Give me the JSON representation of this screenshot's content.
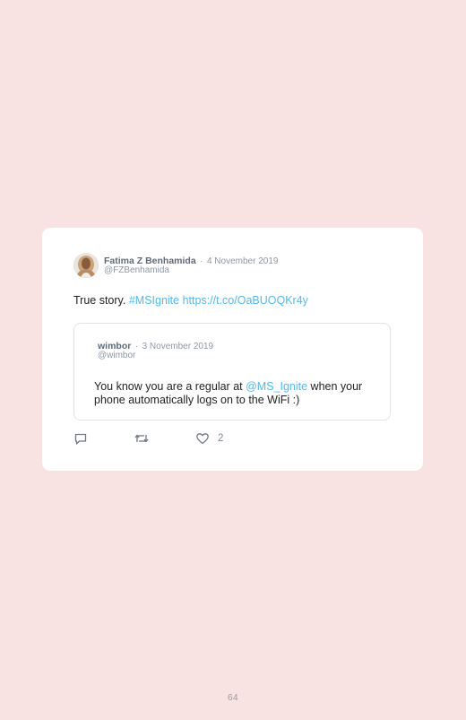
{
  "tweet": {
    "author": {
      "name": "Fatima Z Benhamida",
      "handle": "@FZBenhamida",
      "date": "4 November 2019",
      "separator": "·"
    },
    "text_prefix": "True story. ",
    "hashtag": "#MSIgnite",
    "link": "https://t.co/OaBUOQKr4y",
    "quoted": {
      "name": "wimbor",
      "handle": "@wimbor",
      "date": "3 November 2019",
      "separator": "·",
      "text_before": "You know you are a regular at ",
      "mention": "@MS_Ignite",
      "text_after": " when your phone automatically logs on to the WiFi :)"
    },
    "actions": {
      "reply_icon": "reply-icon",
      "retweet_icon": "retweet-icon",
      "like_icon": "heart-icon",
      "like_count": "2"
    }
  },
  "page": {
    "number": "64"
  },
  "colors": {
    "background": "#f9e3e2",
    "card": "#ffffff",
    "link": "#55b8ec",
    "muted": "#8c97a2",
    "name": "#5e6b7a"
  }
}
